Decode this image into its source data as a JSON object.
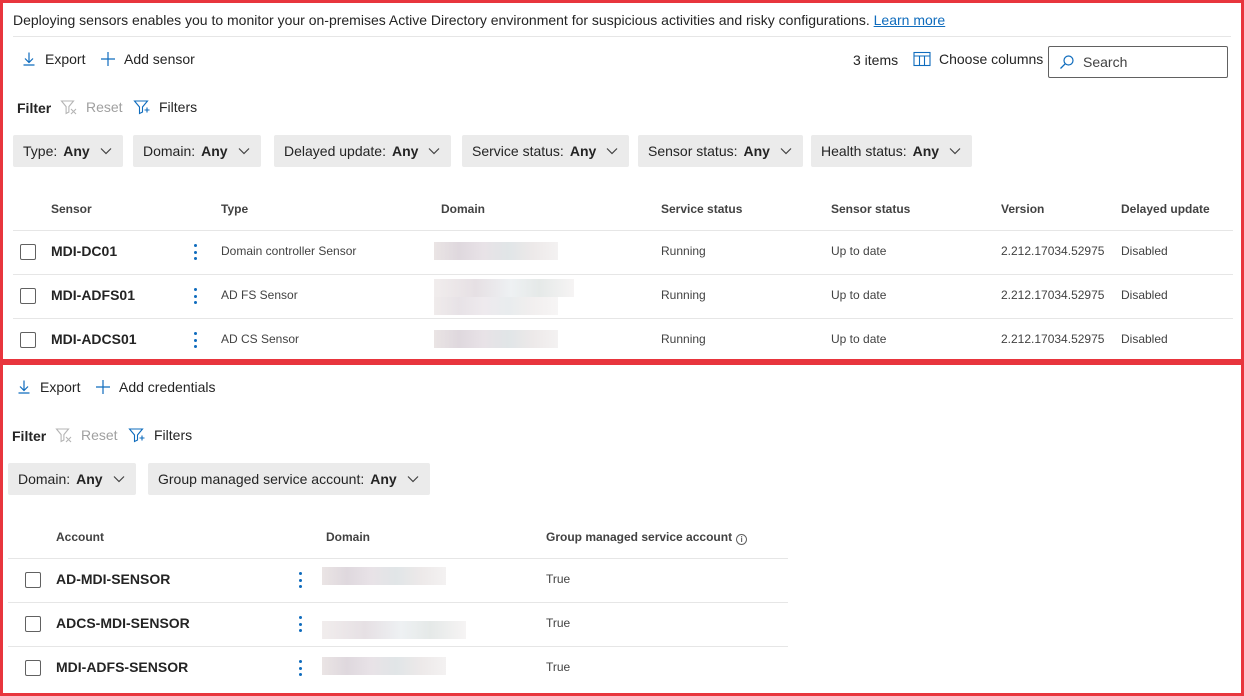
{
  "sensors_panel": {
    "intro_text": "Deploying sensors enables you to monitor your on-premises Active Directory environment for suspicious activities and risky configurations.",
    "learn_more": "Learn more",
    "toolbar": {
      "export_label": "Export",
      "add_sensor_label": "Add sensor",
      "item_count": "3 items",
      "choose_columns_label": "Choose columns",
      "search_placeholder": "Search"
    },
    "filter_bar": {
      "filter_label": "Filter",
      "reset_label": "Reset",
      "filters_label": "Filters"
    },
    "chips": [
      {
        "label": "Type:",
        "value": "Any"
      },
      {
        "label": "Domain:",
        "value": "Any"
      },
      {
        "label": "Delayed update:",
        "value": "Any"
      },
      {
        "label": "Service status:",
        "value": "Any"
      },
      {
        "label": "Sensor status:",
        "value": "Any"
      },
      {
        "label": "Health status:",
        "value": "Any"
      }
    ],
    "columns": [
      "Sensor",
      "Type",
      "Domain",
      "Service status",
      "Sensor status",
      "Version",
      "Delayed update"
    ],
    "rows": [
      {
        "sensor": "MDI-DC01",
        "type": "Domain controller Sensor",
        "service_status": "Running",
        "sensor_status": "Up to date",
        "version": "2.212.17034.52975",
        "delayed_update": "Disabled"
      },
      {
        "sensor": "MDI-ADFS01",
        "type": "AD FS Sensor",
        "service_status": "Running",
        "sensor_status": "Up to date",
        "version": "2.212.17034.52975",
        "delayed_update": "Disabled"
      },
      {
        "sensor": "MDI-ADCS01",
        "type": "AD CS Sensor",
        "service_status": "Running",
        "sensor_status": "Up to date",
        "version": "2.212.17034.52975",
        "delayed_update": "Disabled"
      }
    ]
  },
  "credentials_panel": {
    "toolbar": {
      "export_label": "Export",
      "add_credentials_label": "Add credentials"
    },
    "filter_bar": {
      "filter_label": "Filter",
      "reset_label": "Reset",
      "filters_label": "Filters"
    },
    "chips": [
      {
        "label": "Domain:",
        "value": "Any"
      },
      {
        "label": "Group managed service account:",
        "value": "Any"
      }
    ],
    "columns": [
      "Account",
      "Domain",
      "Group managed service account"
    ],
    "rows": [
      {
        "account": "AD-MDI-SENSOR",
        "gmsa": "True"
      },
      {
        "account": "ADCS-MDI-SENSOR",
        "gmsa": "True"
      },
      {
        "account": "MDI-ADFS-SENSOR",
        "gmsa": "True"
      }
    ]
  },
  "colors": {
    "highlight_border": "#e8353d",
    "link": "#0f6cbd",
    "chip_bg": "#ebebeb"
  }
}
